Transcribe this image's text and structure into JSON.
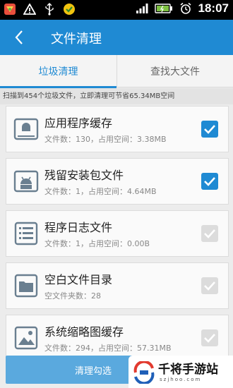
{
  "status_bar": {
    "time": "18:07",
    "icons": [
      "app-icon",
      "alert-icon",
      "usb-icon",
      "app2-icon",
      "signal-icon",
      "battery-icon",
      "alarm-icon"
    ]
  },
  "app_bar": {
    "title": "文件清理",
    "back_icon": "chevron-left-icon"
  },
  "tabs": [
    {
      "label": "垃圾清理",
      "active": true
    },
    {
      "label": "查找大文件",
      "active": false
    }
  ],
  "summary": "扫描到454个垃圾文件，立即清理可节省65.34MB空间",
  "items": [
    {
      "name": "应用程序缓存",
      "meta": "文件数：130，占用空间：3.38MB",
      "icon": "app-cache-icon",
      "checked": true
    },
    {
      "name": "残留安装包文件",
      "meta": "文件数：1，占用空间：4.64MB",
      "icon": "android-package-icon",
      "checked": true
    },
    {
      "name": "程序日志文件",
      "meta": "文件数：1，占用空间：0.00B",
      "icon": "log-file-icon",
      "checked": false
    },
    {
      "name": "空白文件目录",
      "meta": "空文件夹数：28",
      "icon": "folder-icon",
      "checked": false
    },
    {
      "name": "系统缩略图缓存",
      "meta": "文件数：294，占用空间：57.31MB",
      "icon": "image-icon",
      "checked": false
    }
  ],
  "bottom_button": {
    "label": "清理勾选"
  },
  "watermark": {
    "text": "千将手游站",
    "sub": "szjhoo.com"
  },
  "colors": {
    "accent": "#1f8ad3",
    "button": "#5aa9de"
  }
}
